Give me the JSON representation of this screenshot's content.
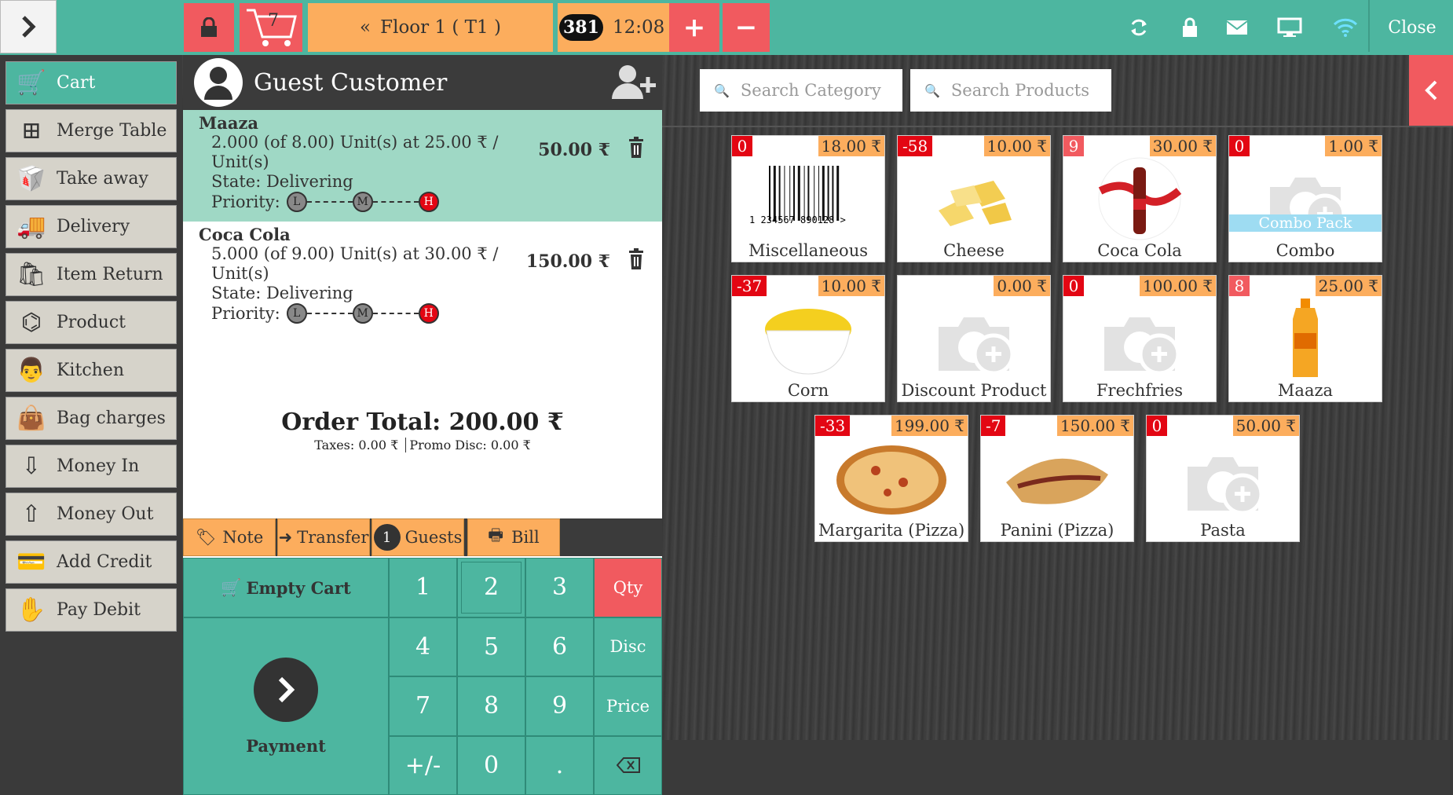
{
  "topbar": {
    "cart_count": "7",
    "floor_label": "Floor 1 ( T1 )",
    "order_number": "381",
    "time": "12:08",
    "close_label": "Close"
  },
  "sidebar": {
    "items": [
      {
        "label": "Cart",
        "icon": "cart-icon",
        "active": true
      },
      {
        "label": "Merge Table",
        "icon": "merge-table-icon"
      },
      {
        "label": "Take away",
        "icon": "take-away-icon"
      },
      {
        "label": "Delivery",
        "icon": "delivery-truck-icon"
      },
      {
        "label": "Item Return",
        "icon": "return-bag-icon"
      },
      {
        "label": "Product",
        "icon": "product-tree-icon"
      },
      {
        "label": "Kitchen",
        "icon": "kitchen-chef-icon"
      },
      {
        "label": "Bag charges",
        "icon": "bag-icon"
      },
      {
        "label": "Money In",
        "icon": "money-in-icon"
      },
      {
        "label": "Money Out",
        "icon": "money-out-icon"
      },
      {
        "label": "Add Credit",
        "icon": "add-credit-icon"
      },
      {
        "label": "Pay Debit",
        "icon": "pay-debit-icon"
      }
    ]
  },
  "customer": {
    "name": "Guest Customer"
  },
  "order_lines": [
    {
      "name": "Maaza",
      "qty_text": "2.000 (of 8.00) Unit(s) at 25.00 ₹ /",
      "unit_text": "Unit(s)",
      "state": "State: Delivering",
      "priority_label": "Priority:",
      "price": "50.00 ₹",
      "selected": true
    },
    {
      "name": "Coca Cola",
      "qty_text": "5.000 (of 9.00) Unit(s) at 30.00 ₹ /",
      "unit_text": "Unit(s)",
      "state": "State: Delivering",
      "priority_label": "Priority:",
      "price": "150.00 ₹",
      "selected": false
    }
  ],
  "priority_levels": [
    "L",
    "M",
    "H"
  ],
  "totals": {
    "order_total": "Order Total: 200.00 ₹",
    "taxes": "Taxes: 0.00 ₹",
    "promo": "Promo Disc: 0.00 ₹"
  },
  "actions": {
    "note": "Note",
    "transfer": "Transfer",
    "guests_count": "1",
    "guests": "Guests",
    "bill": "Bill"
  },
  "keypad": {
    "empty_cart": "Empty Cart",
    "payment": "Payment",
    "keys": [
      "1",
      "2",
      "3",
      "4",
      "5",
      "6",
      "7",
      "8",
      "9",
      "+/-",
      "0",
      "."
    ],
    "modes": [
      "Qty",
      "Disc",
      "Price"
    ]
  },
  "search": {
    "category_placeholder": "Search Category",
    "products_placeholder": "Search Products"
  },
  "products": [
    {
      "name": "Miscellaneous",
      "stock": "0",
      "price": "18.00 ₹",
      "image": "barcode",
      "barcode_text": "1  234567  890128  >"
    },
    {
      "name": "Cheese",
      "stock": "-58",
      "price": "10.00 ₹",
      "image": "cheese"
    },
    {
      "name": "Coca Cola",
      "stock": "9",
      "price": "30.00 ₹",
      "image": "cocacola"
    },
    {
      "name": "Combo",
      "stock": "0",
      "price": "1.00 ₹",
      "image": "camera",
      "ribbon": "Combo Pack"
    },
    {
      "name": "Corn",
      "stock": "-37",
      "price": "10.00 ₹",
      "image": "corn"
    },
    {
      "name": "Discount Product",
      "stock": "",
      "price": "0.00 ₹",
      "image": "camera"
    },
    {
      "name": "Frechfries",
      "stock": "0",
      "price": "100.00 ₹",
      "image": "camera"
    },
    {
      "name": "Maaza",
      "stock": "8",
      "price": "25.00 ₹",
      "image": "maaza"
    },
    {
      "name": "Margarita (Pizza)",
      "stock": "-33",
      "price": "199.00 ₹",
      "image": "pizza"
    },
    {
      "name": "Panini (Pizza)",
      "stock": "-7",
      "price": "150.00 ₹",
      "image": "panini"
    },
    {
      "name": "Pasta",
      "stock": "0",
      "price": "50.00 ₹",
      "image": "camera"
    }
  ],
  "colors": {
    "accent": "#4db6a0",
    "danger": "#f15a5f",
    "warning": "#fcad5d",
    "selected_line": "#9fd8c5"
  }
}
